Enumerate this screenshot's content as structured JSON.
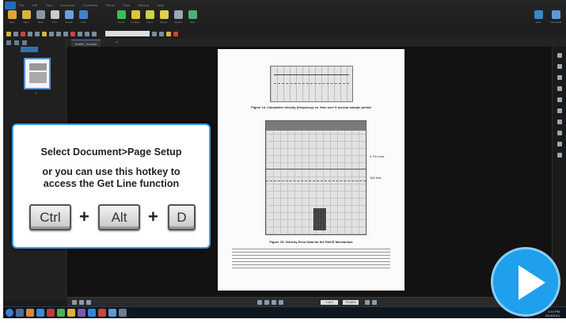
{
  "ribbon": {
    "menu_tabs": [
      "File",
      "Edit",
      "View",
      "Document",
      "Comments",
      "Forms",
      "Tools",
      "Window",
      "Help"
    ],
    "tools": [
      "New",
      "Open",
      "Save",
      "Print",
      "E-mail",
      "Undo",
      "Create",
      "Combine",
      "Insert",
      "Export",
      "Redact",
      "Find"
    ],
    "right_tools": [
      "Tools",
      "Comments"
    ]
  },
  "document": {
    "tab_label": "testfile_Sample",
    "page_number": "1",
    "figure1_caption": "Figure 14. Calculated velocity (frequency) vs. time over 5 second sample period",
    "figure2_caption": "Figure 15. Velocity Error Data for the FAICE Mechanism",
    "annotation1": "0.7% error",
    "annotation2": "100 kHz"
  },
  "status": {
    "page_field": "1 of 1",
    "zoom": "79.54%"
  },
  "taskbar": {
    "clock_time": "4:10 PM",
    "clock_date": "5/14/2013"
  },
  "overlay": {
    "line1": "Select Document>Page Setup",
    "line2": "or you can use this hotkey to",
    "line3": "access the Get Line function",
    "keys": [
      "Ctrl",
      "Alt",
      "D"
    ],
    "plus": "+"
  },
  "colors": {
    "accent": "#1ea0ec",
    "callout_border": "#3aa0e8"
  }
}
